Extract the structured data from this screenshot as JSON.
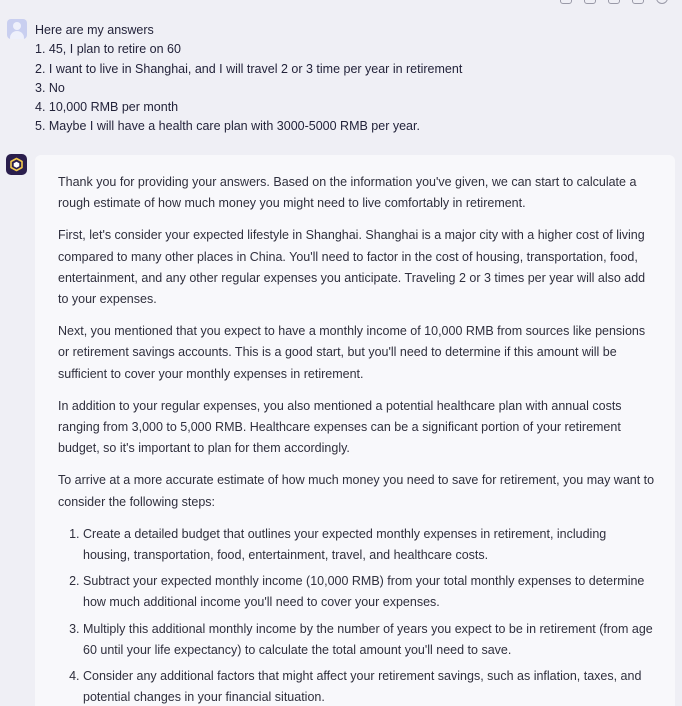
{
  "colors": {
    "background": "#efeff5",
    "card": "#f8f8fb",
    "bot_avatar": "#2a1e4d",
    "bot_avatar_accent": "#f2c94c",
    "user_avatar": "#c9cff0"
  },
  "top_actions": {
    "icons": [
      "up-icon",
      "copy-icon",
      "share-icon",
      "edit-icon",
      "more-icon"
    ]
  },
  "user_message": {
    "avatar_icon": "user-avatar-icon",
    "lines": [
      "Here are my answers",
      "1. 45, I plan to retire on 60",
      "2. I want to live in Shanghai, and I will travel 2 or 3 time per year in retirement",
      "3. No",
      "4. 10,000 RMB per month",
      "5. Maybe I will have a health care plan with 3000-5000 RMB per year."
    ]
  },
  "bot_message": {
    "avatar_icon": "bot-logo-icon",
    "paragraphs": [
      "Thank you for providing your answers. Based on the information you've given, we can start to calculate a rough estimate of how much money you might need to live comfortably in retirement.",
      "First, let's consider your expected lifestyle in Shanghai. Shanghai is a major city with a higher cost of living compared to many other places in China. You'll need to factor in the cost of housing, transportation, food, entertainment, and any other regular expenses you anticipate. Traveling 2 or 3 times per year will also add to your expenses.",
      "Next, you mentioned that you expect to have a monthly income of 10,000 RMB from sources like pensions or retirement savings accounts. This is a good start, but you'll need to determine if this amount will be sufficient to cover your monthly expenses in retirement.",
      "In addition to your regular expenses, you also mentioned a potential healthcare plan with annual costs ranging from 3,000 to 5,000 RMB. Healthcare expenses can be a significant portion of your retirement budget, so it's important to plan for them accordingly.",
      "To arrive at a more accurate estimate of how much money you need to save for retirement, you may want to consider the following steps:"
    ],
    "steps": [
      "Create a detailed budget that outlines your expected monthly expenses in retirement, including housing, transportation, food, entertainment, travel, and healthcare costs.",
      "Subtract your expected monthly income (10,000 RMB) from your total monthly expenses to determine how much additional income you'll need to cover your expenses.",
      "Multiply this additional monthly income by the number of years you expect to be in retirement (from age 60 until your life expectancy) to calculate the total amount you'll need to save.",
      "Consider any additional factors that might affect your retirement savings, such as inflation, taxes, and potential changes in your financial situation."
    ]
  }
}
